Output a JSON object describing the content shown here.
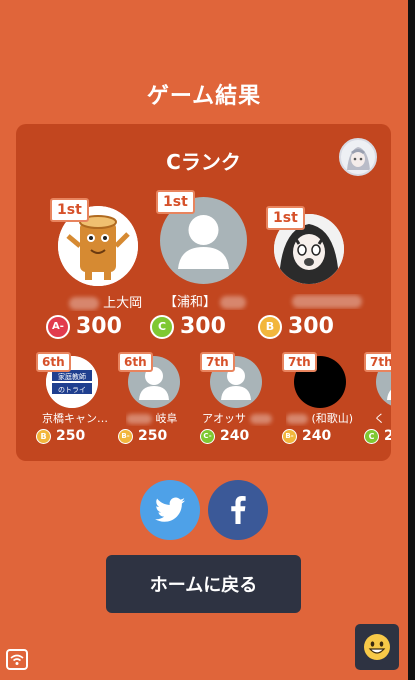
{
  "header": {
    "title": "ゲーム結果"
  },
  "result": {
    "rank_title": "Cランク",
    "top_players": [
      {
        "position": "1st",
        "name": "上大岡",
        "rank": "A-",
        "rank_color": "#e23b4d",
        "score": "300"
      },
      {
        "position": "1st",
        "name": "【浦和】",
        "rank": "C",
        "rank_color": "#7fc832",
        "score": "300"
      },
      {
        "position": "1st",
        "name": "",
        "rank": "B",
        "rank_color": "#f2b63c",
        "score": "300"
      }
    ],
    "other_players": [
      {
        "position": "6th",
        "name": "京橋キャン…",
        "rank": "B",
        "rank_color": "#f2b63c",
        "score": "250",
        "avatar_text": "家庭教師のトライ"
      },
      {
        "position": "6th",
        "name": "岐阜",
        "rank": "B-",
        "rank_color": "#f2b63c",
        "score": "250"
      },
      {
        "position": "7th",
        "name": "アオッサ",
        "rank": "C-",
        "rank_color": "#7fc832",
        "score": "240"
      },
      {
        "position": "7th",
        "name": "(和歌山)",
        "rank": "B-",
        "rank_color": "#f2b63c",
        "score": "240"
      },
      {
        "position": "7th",
        "name": "く",
        "rank": "C",
        "rank_color": "#7fc832",
        "score": "2"
      }
    ]
  },
  "share": {
    "twitter_color": "#4ea1e8",
    "facebook_color": "#3b5998"
  },
  "actions": {
    "home_label": "ホームに戻る"
  },
  "colors": {
    "background": "#e0653a",
    "panel": "#c2461f",
    "button": "#2e3342"
  },
  "icons": {
    "twitter": "twitter-bird-icon",
    "facebook": "facebook-f-icon",
    "emoji": "grin-emoji-icon",
    "wifi": "wifi-icon"
  }
}
